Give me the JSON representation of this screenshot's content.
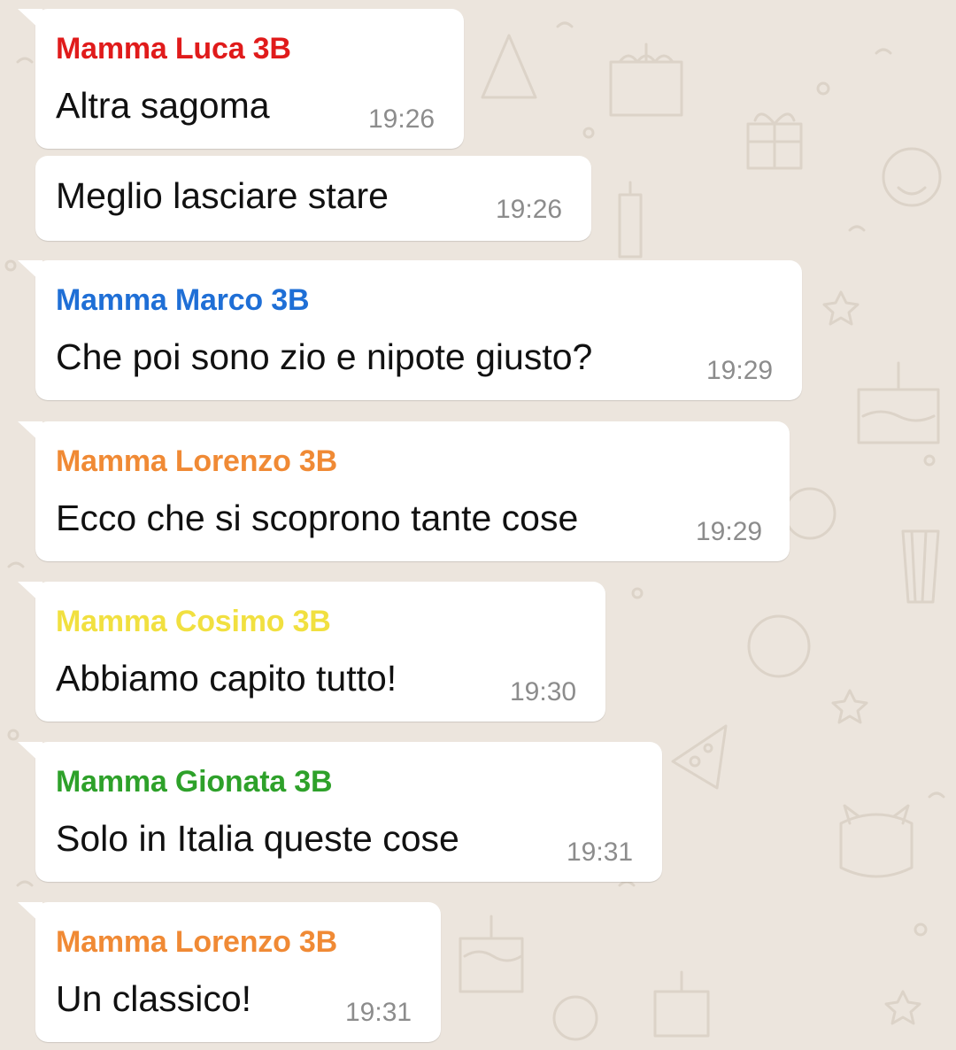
{
  "colors": {
    "background": "#ece5dd",
    "bubble": "#ffffff",
    "timestamp": "#8c8c8c"
  },
  "messages": [
    {
      "sender": "Mamma Luca 3B",
      "sender_color": "#e01b1b",
      "text": "Altra sagoma",
      "time": "19:26"
    },
    {
      "sender": "",
      "sender_color": "",
      "text": "Meglio lasciare stare",
      "time": "19:26"
    },
    {
      "sender": "Mamma Marco 3B",
      "sender_color": "#1f6fd6",
      "text": "Che poi sono zio e nipote giusto?",
      "time": "19:29"
    },
    {
      "sender": "Mamma Lorenzo 3B",
      "sender_color": "#f08a35",
      "text": "Ecco che si scoprono tante cose",
      "time": "19:29"
    },
    {
      "sender": "Mamma Cosimo 3B",
      "sender_color": "#f1e040",
      "text": "Abbiamo capito tutto!",
      "time": "19:30"
    },
    {
      "sender": "Mamma Gionata 3B",
      "sender_color": "#2ea12a",
      "text": "Solo in Italia queste cose",
      "time": "19:31"
    },
    {
      "sender": "Mamma Lorenzo 3B",
      "sender_color": "#f08a35",
      "text": "Un classico!",
      "time": "19:31"
    }
  ]
}
